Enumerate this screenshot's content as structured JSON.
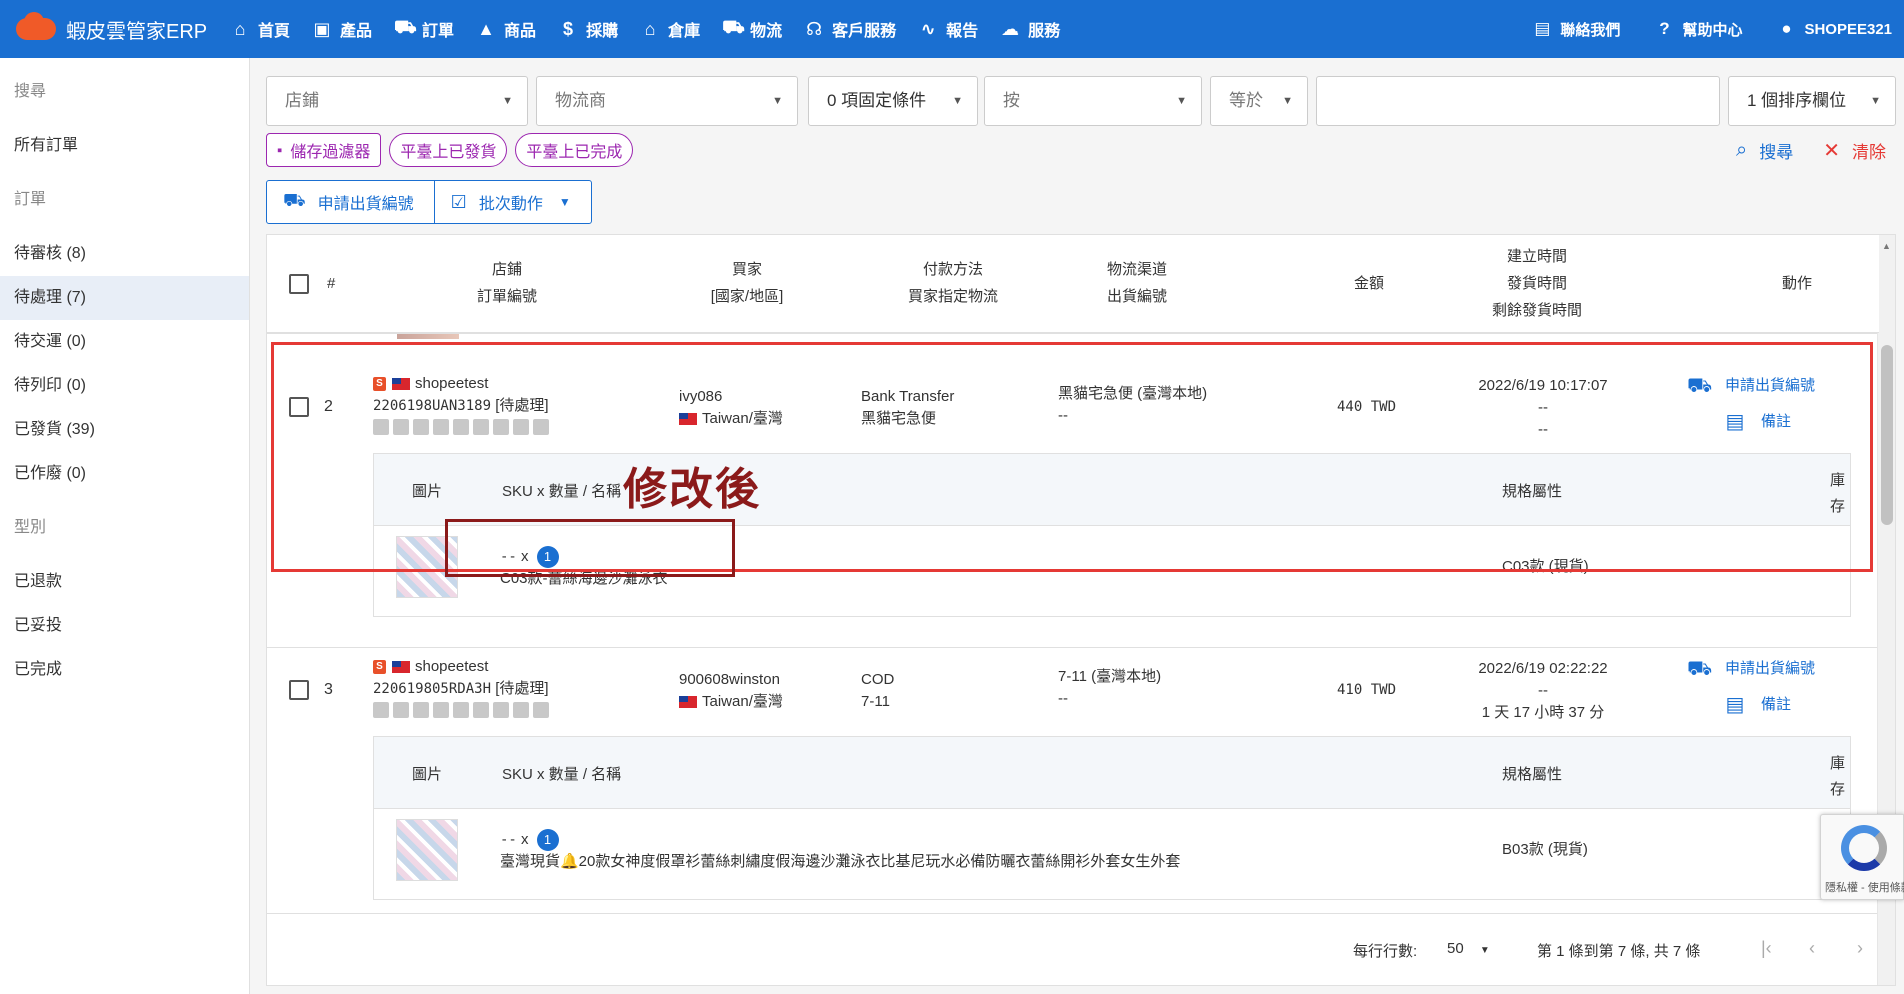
{
  "topbar": {
    "brand": "蝦皮雲管家ERP",
    "nav": [
      {
        "label": "首頁",
        "icon": "home-icon",
        "glyph": "⌂"
      },
      {
        "label": "產品",
        "icon": "bag-icon",
        "glyph": "▣"
      },
      {
        "label": "訂單",
        "icon": "cart-icon",
        "glyph": "⛟"
      },
      {
        "label": "商品",
        "icon": "shapes-icon",
        "glyph": "▲"
      },
      {
        "label": "採購",
        "icon": "dollar-icon",
        "glyph": "$"
      },
      {
        "label": "倉庫",
        "icon": "warehouse-icon",
        "glyph": "⌂"
      },
      {
        "label": "物流",
        "icon": "truck-icon",
        "glyph": "⛟"
      },
      {
        "label": "客戶服務",
        "icon": "support-icon",
        "glyph": "☊"
      },
      {
        "label": "報告",
        "icon": "chart-icon",
        "glyph": "∿"
      },
      {
        "label": "服務",
        "icon": "cloud-icon",
        "glyph": "☁"
      }
    ],
    "right": [
      {
        "label": "聯絡我們",
        "icon": "contact-icon",
        "glyph": "▤"
      },
      {
        "label": "幫助中心",
        "icon": "help-icon",
        "glyph": "?"
      },
      {
        "label": "SHOPEE321",
        "icon": "account-icon",
        "glyph": "●"
      }
    ]
  },
  "sidebar": {
    "items": [
      {
        "label": "搜尋",
        "muted": true
      },
      {
        "label": "所有訂單"
      },
      {
        "label": "訂單",
        "muted": true
      },
      {
        "label": "待審核 (8)"
      },
      {
        "label": "待處理 (7)",
        "active": true
      },
      {
        "label": "待交運 (0)"
      },
      {
        "label": "待列印 (0)"
      },
      {
        "label": "已發貨 (39)"
      },
      {
        "label": "已作廢 (0)"
      },
      {
        "label": "型別",
        "muted": true
      },
      {
        "label": "已退款"
      },
      {
        "label": "已妥投"
      },
      {
        "label": "已完成"
      }
    ]
  },
  "filters": {
    "shop": "店鋪",
    "carrier": "物流商",
    "fixed": "0 項固定條件",
    "by": "按",
    "op": "等於",
    "value": "",
    "sort": "1 個排序欄位"
  },
  "chips": {
    "save": "儲存過濾器",
    "shipped": "平臺上已發貨",
    "done": "平臺上已完成"
  },
  "actions": {
    "search": "搜尋",
    "clear": "清除"
  },
  "buttons": {
    "apply": "申請出貨編號",
    "batch": "批次動作"
  },
  "table": {
    "headers": {
      "num": "#",
      "shop": [
        "店鋪",
        "訂單編號"
      ],
      "buyer": [
        "買家",
        "[國家/地區]"
      ],
      "payment": [
        "付款方法",
        "買家指定物流"
      ],
      "logistics": [
        "物流渠道",
        "出貨編號"
      ],
      "amount": "金額",
      "time": [
        "建立時間",
        "發貨時間",
        "剩餘發貨時間"
      ],
      "action": "動作"
    },
    "partial_text": "..",
    "sub_headers": {
      "image": "圖片",
      "sku": "SKU x 數量 / 名稱",
      "spec": "規格屬性",
      "stock": "庫存"
    },
    "rows": [
      {
        "index": "2",
        "shop": "shopeetest",
        "order_no": "2206198UAN3189",
        "status": "[待處理]",
        "buyer": "ivy086",
        "country": "Taiwan/臺灣",
        "payment": "Bank Transfer",
        "buyer_logistics": "黑貓宅急便",
        "channel": "黑貓宅急便 (臺灣本地)",
        "ship_no": "--",
        "amount": "440 TWD",
        "created": "2022/6/19 10:17:07",
        "shipped": "--",
        "remaining": "--",
        "action_apply": "申請出貨編號",
        "action_note": "備註",
        "item": {
          "sku": "--",
          "x": "x",
          "qty": "1",
          "name": "C03款-蕾絲海邊沙灘泳衣",
          "spec": "C03款 (現貨)"
        }
      },
      {
        "index": "3",
        "shop": "shopeetest",
        "order_no": "220619805RDA3H",
        "status": "[待處理]",
        "buyer": "900608winston",
        "country": "Taiwan/臺灣",
        "payment": "COD",
        "buyer_logistics": "7-11",
        "channel": "7-11 (臺灣本地)",
        "ship_no": "--",
        "amount": "410 TWD",
        "created": "2022/6/19 02:22:22",
        "shipped": "--",
        "remaining": "1 天 17 小時 37 分",
        "action_apply": "申請出貨編號",
        "action_note": "備註",
        "item": {
          "sku": "--",
          "x": "x",
          "qty": "1",
          "name": "臺灣現貨🔔20款女神度假罩衫蕾絲刺繡度假海邊沙灘泳衣比基尼玩水必備防曬衣蕾絲開衫外套女生外套",
          "spec": "B03款 (現貨)"
        }
      }
    ]
  },
  "annotation": "修改後",
  "pager": {
    "rows_label": "每行行數:",
    "rows_value": "50",
    "range": "第 1 條到第 7 條, 共 7 條"
  },
  "recaptcha": "隱私權 - 使用條款",
  "colors": {
    "primary": "#1a6fd1",
    "chip": "#9c27b0",
    "highlight": "#e53935",
    "annotation": "#8b1a1a"
  }
}
